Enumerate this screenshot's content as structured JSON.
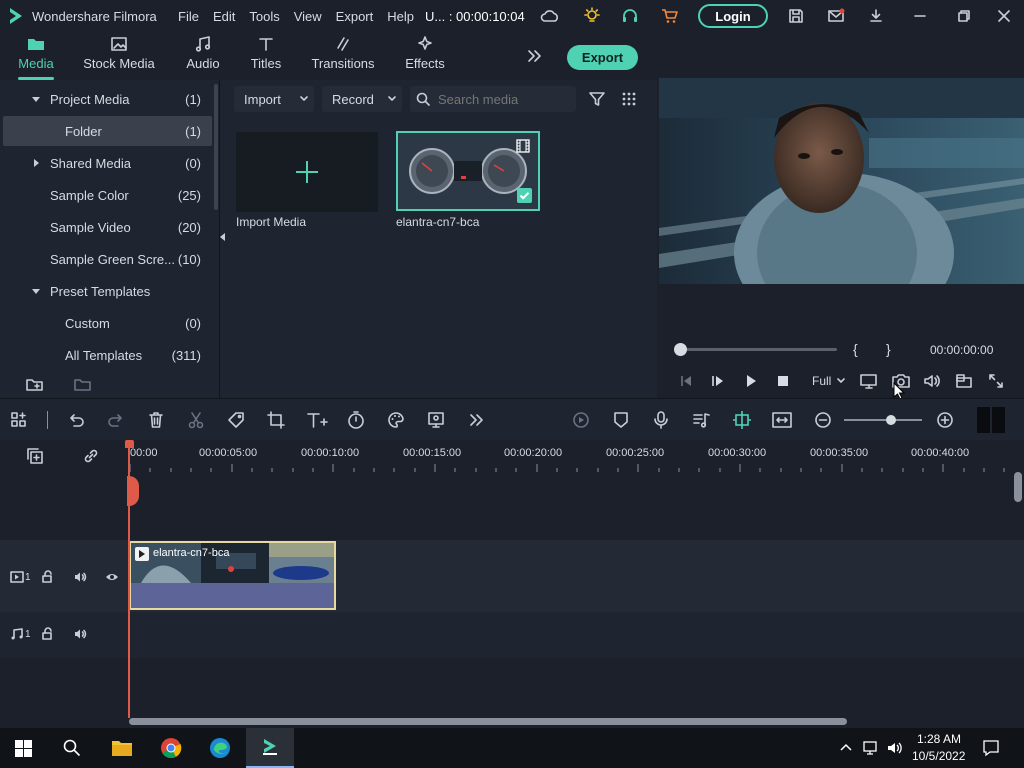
{
  "app": {
    "title": "Wondershare Filmora",
    "menu": [
      "File",
      "Edit",
      "Tools",
      "View",
      "Export",
      "Help"
    ],
    "project_name": "U... : 00:00:10:04",
    "login_label": "Login"
  },
  "tabs": [
    {
      "label": "Media",
      "active": true
    },
    {
      "label": "Stock Media"
    },
    {
      "label": "Audio"
    },
    {
      "label": "Titles"
    },
    {
      "label": "Transitions"
    },
    {
      "label": "Effects"
    }
  ],
  "export_label": "Export",
  "sidebar": {
    "items": [
      {
        "label": "Project Media",
        "count": "(1)"
      },
      {
        "label": "Folder",
        "count": "(1)"
      },
      {
        "label": "Shared Media",
        "count": "(0)"
      },
      {
        "label": "Sample Color",
        "count": "(25)"
      },
      {
        "label": "Sample Video",
        "count": "(20)"
      },
      {
        "label": "Sample Green Scre...",
        "count": "(10)"
      },
      {
        "label": "Preset Templates",
        "count": ""
      },
      {
        "label": "Custom",
        "count": "(0)"
      },
      {
        "label": "All Templates",
        "count": "(311)"
      }
    ]
  },
  "media": {
    "import_label": "Import",
    "record_label": "Record",
    "search_placeholder": "Search media",
    "import_media_label": "Import Media",
    "clip_name": "elantra-cn7-bca"
  },
  "preview": {
    "mark_in": "{",
    "mark_out": "}",
    "timecode": "00:00:00:00",
    "quality": "Full"
  },
  "timeline": {
    "ruler": [
      "00:00",
      "00:00:05:00",
      "00:00:10:00",
      "00:00:15:00",
      "00:00:20:00",
      "00:00:25:00",
      "00:00:30:00",
      "00:00:35:00",
      "00:00:40:00"
    ],
    "clip_label": "elantra-cn7-bca",
    "video_track": "1",
    "audio_track": "1"
  },
  "taskbar": {
    "time": "1:28 AM",
    "date": "10/5/2022"
  },
  "colors": {
    "accent": "#4fd1b4",
    "clip_border": "#e8d9a0",
    "playhead": "#e05a4a"
  }
}
